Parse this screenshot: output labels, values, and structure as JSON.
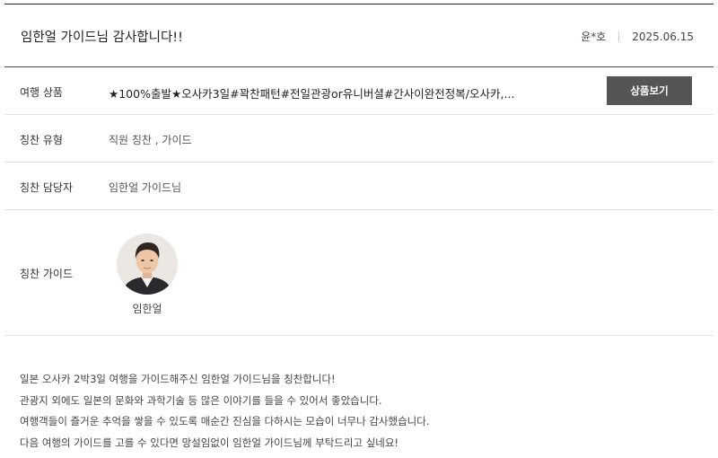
{
  "header": {
    "title": "임한얼 가이드님 감사합니다!!",
    "author": "윤*호",
    "date": "2025.06.15"
  },
  "rows": {
    "product": {
      "label": "여행 상품",
      "value": "★100%출발★오사카3일#꽉찬패턴#전일관광or유니버셜#간사이완전정복/오사카,...",
      "button": "상품보기"
    },
    "praise_type": {
      "label": "칭찬 유형",
      "value": "직원 칭찬 , 가이드"
    },
    "praise_staff": {
      "label": "칭찬 담당자",
      "value": "임한얼 가이드님"
    },
    "praise_guide": {
      "label": "칭찬 가이드",
      "guide_name": "임한얼"
    }
  },
  "message": {
    "lines": [
      "일본 오사카 2박3일 여행을 가이드해주신 임한얼 가이드님을 칭찬합니다!",
      "관광지 외에도 일본의 문화와 과학기술 등 많은 이야기를 들을 수 있어서 좋았습니다.",
      "여행객들이 즐거운 추억을 쌓을 수 있도록 매순간 진심을 다하시는 모습이 너무나 감사했습니다.",
      "다음 여행의 가이드를 고를 수 있다면 망설임없이 임한얼 가이드님께 부탁드리고 싶네요!"
    ]
  }
}
